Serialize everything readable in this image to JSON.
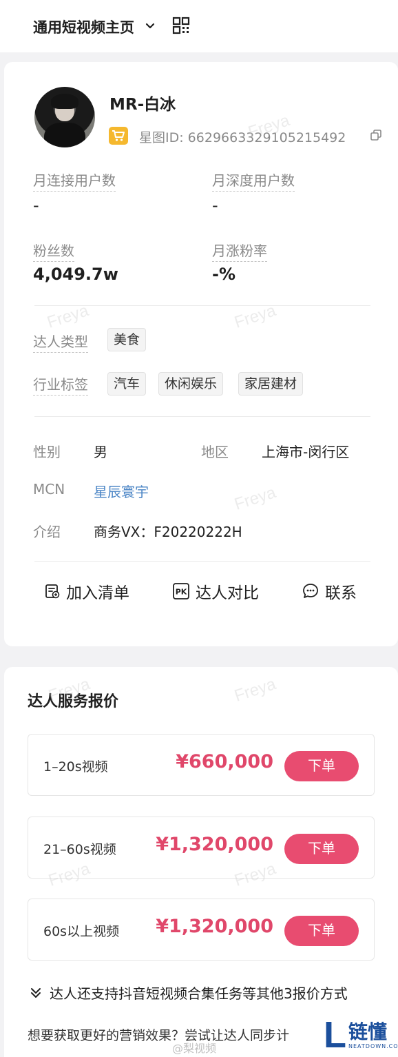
{
  "header": {
    "title": "通用短视频主页"
  },
  "profile": {
    "name": "MR-白冰",
    "xingtu_id": "星图ID: 6629663329105215492"
  },
  "metrics": [
    {
      "label": "月连接用户数",
      "value": "-"
    },
    {
      "label": "月深度用户数",
      "value": "-"
    },
    {
      "label": "粉丝数",
      "value": "4,049.7w"
    },
    {
      "label": "月涨粉率",
      "value": "-%"
    }
  ],
  "tags": {
    "talent_type_label": "达人类型",
    "talent_types": [
      "美食"
    ],
    "industry_label": "行业标签",
    "industries": [
      "汽车",
      "休闲娱乐",
      "家居建材"
    ]
  },
  "info": {
    "gender_label": "性别",
    "gender": "男",
    "region_label": "地区",
    "region": "上海市-闵行区",
    "mcn_label": "MCN",
    "mcn": "星辰寰宇",
    "intro_label": "介绍",
    "intro": "商务VX：F20220222H"
  },
  "actions": {
    "add_list": "加入清单",
    "compare": "达人对比",
    "contact": "联系"
  },
  "pricing": {
    "title": "达人服务报价",
    "rows": [
      {
        "name": "1–20s视频",
        "price": "¥660,000",
        "button": "下单"
      },
      {
        "name": "21–60s视频",
        "price": "¥1,320,000",
        "button": "下单"
      },
      {
        "name": "60s以上视频",
        "price": "¥1,320,000",
        "button": "下单"
      }
    ],
    "more": "达人还支持抖音短视频合集任务等其他3报价方式",
    "hint": "想要获取更好的营销效果？尝试让达人同步计"
  },
  "overlay": {
    "watermark": "Freya",
    "weibo": "@梨视频",
    "logo_letter": "L",
    "logo_brand": "链懂",
    "logo_sub": "NEATDOWN.COM"
  },
  "colors": {
    "accent": "#e84c70",
    "price": "#e0476a",
    "link": "#4c86c6",
    "badge": "#f5b82e"
  }
}
